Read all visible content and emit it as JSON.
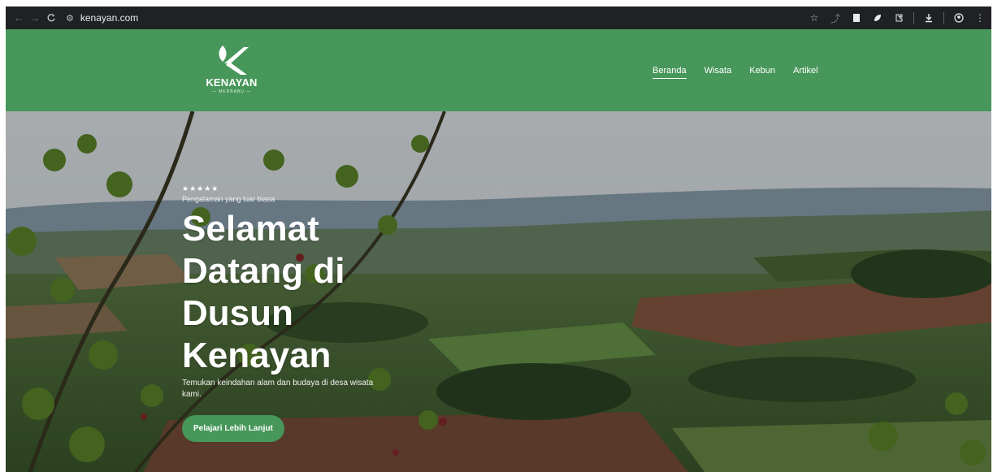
{
  "browser": {
    "url": "kenayan.com",
    "icons": [
      "back-icon",
      "forward-icon",
      "reload-icon",
      "site-settings-icon",
      "bookmark-star-icon",
      "extensions-icon",
      "download-icon",
      "profile-icon",
      "menu-icon"
    ]
  },
  "site": {
    "logo_text": "KENAYAN",
    "logo_sub": "— MERBABU —",
    "nav": [
      {
        "label": "Beranda",
        "active": true
      },
      {
        "label": "Wisata"
      },
      {
        "label": "Kebun"
      },
      {
        "label": "Artikel"
      }
    ],
    "brand_color": "#47975a"
  },
  "hero": {
    "stars": "★★★★★",
    "tagline": "Pengalaman yang luar biasa",
    "title_line1": "Selamat",
    "title_line2": "Datang di",
    "title_line3": "Dusun Kenayan",
    "description": "Temukan keindahan alam dan budaya di desa wisata kami.",
    "cta_label": "Pelajari Lebih Lanjut"
  }
}
